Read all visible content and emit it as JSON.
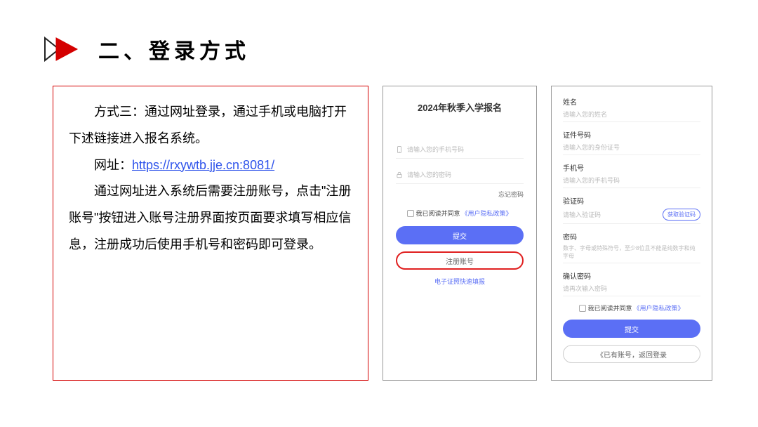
{
  "header": {
    "title": "二、登录方式"
  },
  "textbox": {
    "p1_before": "方式三：通过网址登录，通过手机或电脑打开下述链接进入报名系统。",
    "p2_prefix": "网址：",
    "url": "https://rxywtb.jje.cn:8081/",
    "p3": "通过网址进入系统后需要注册账号，点击\"注册账号\"按钮进入账号注册界面按页面要求填写相应信息，注册成功后使用手机号和密码即可登录。"
  },
  "login": {
    "title": "2024年秋季入学报名",
    "phone_ph": "请输入您的手机号码",
    "pwd_ph": "请输入您的密码",
    "forgot": "忘记密码",
    "agree_text": "我已阅读并同意",
    "policy": "《用户隐私政策》",
    "submit": "提交",
    "register": "注册账号",
    "ecert": "电子证照快速填报"
  },
  "register": {
    "name_label": "姓名",
    "name_ph": "请输入您的姓名",
    "id_label": "证件号码",
    "id_ph": "请输入您的身份证号",
    "phone_label": "手机号",
    "phone_ph": "请输入您的手机号码",
    "code_label": "验证码",
    "code_ph": "请输入验证码",
    "get_code": "获取验证码",
    "pwd_label": "密码",
    "pwd_ph": "数字、字母或特殊符号，至少8位且不能是纯数字和纯字母",
    "confirm_label": "确认密码",
    "confirm_ph": "请再次输入密码",
    "agree_text": "我已阅读并同意",
    "policy": "《用户隐私政策》",
    "submit": "提交",
    "back": "《已有账号，返回登录"
  }
}
